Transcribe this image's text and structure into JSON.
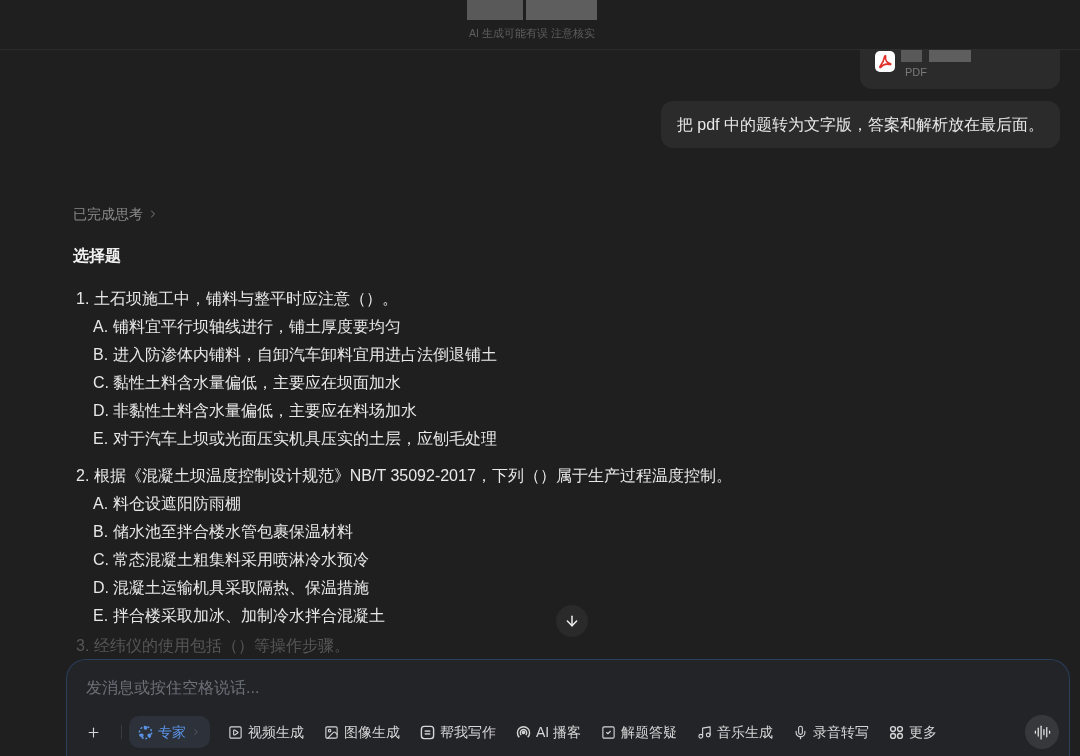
{
  "header": {
    "notice": "AI 生成可能有误 注意核实"
  },
  "attachment": {
    "file_type": "PDF"
  },
  "user_message": {
    "text": "把 pdf 中的题转为文字版，答案和解析放在最后面。"
  },
  "response": {
    "thinking_status": "已完成思考",
    "heading": "选择题",
    "questions": [
      {
        "text": "1. 土石坝施工中，铺料与整平时应注意（）。",
        "faded": false,
        "options": [
          "A. 铺料宜平行坝轴线进行，铺土厚度要均匀",
          "B. 进入防渗体内铺料，自卸汽车卸料宜用进占法倒退铺土",
          "C. 黏性土料含水量偏低，主要应在坝面加水",
          "D. 非黏性土料含水量偏低，主要应在料场加水",
          "E. 对于汽车上坝或光面压实机具压实的土层，应刨毛处理"
        ]
      },
      {
        "text": "2. 根据《混凝土坝温度控制设计规范》NB/T 35092-2017，下列（）属于生产过程温度控制。",
        "faded": false,
        "options": [
          "A. 料仓设遮阳防雨棚",
          "B. 储水池至拌合楼水管包裹保温材料",
          "C. 常态混凝土粗集料采用喷淋冷水预冷",
          "D. 混凝土运输机具采取隔热、保温措施",
          "E. 拌合楼采取加冰、加制冷水拌合混凝土"
        ]
      },
      {
        "text": "3. 经纬仪的使用包括（）等操作步骤。",
        "faded": true
      }
    ]
  },
  "composer": {
    "placeholder": "发消息或按住空格说话...",
    "tools": [
      {
        "label": "专家",
        "kind": "expert",
        "selected": true
      },
      {
        "label": "视频生成",
        "kind": "video",
        "selected": false
      },
      {
        "label": "图像生成",
        "kind": "image",
        "selected": false
      },
      {
        "label": "帮我写作",
        "kind": "writing",
        "selected": false
      },
      {
        "label": "AI 播客",
        "kind": "podcast",
        "selected": false
      },
      {
        "label": "解题答疑",
        "kind": "solve",
        "selected": false
      },
      {
        "label": "音乐生成",
        "kind": "music",
        "selected": false
      },
      {
        "label": "录音转写",
        "kind": "transcribe",
        "selected": false
      },
      {
        "label": "更多",
        "kind": "more",
        "selected": false
      }
    ]
  }
}
